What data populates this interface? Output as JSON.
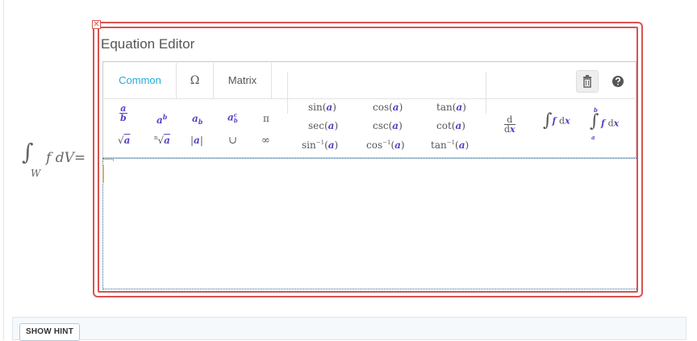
{
  "expression": {
    "integral_sign": "∫",
    "subscript": "W",
    "integrand": "f dV",
    "equals": "="
  },
  "close_icon_glyph": "✕",
  "editor": {
    "title": "Equation Editor",
    "tabs": [
      {
        "label": "Common",
        "active": true
      },
      {
        "label": "Ω",
        "active": false
      },
      {
        "label": "Matrix",
        "active": false
      }
    ],
    "toolbar": {
      "trash_icon": "trash-icon",
      "help_icon": "help-circle-icon"
    },
    "symbols": {
      "fraction": {
        "num": "a",
        "den": "b"
      },
      "power": {
        "base": "a",
        "sup": "b"
      },
      "subscript": {
        "base": "a",
        "sub": "b"
      },
      "sub_sup": {
        "base": "a",
        "sup": "c",
        "sub": "b"
      },
      "pi": "π",
      "sqrt": {
        "sign": "√",
        "arg": "a"
      },
      "nth_root": {
        "index": "n",
        "sign": "√",
        "arg": "a"
      },
      "abs": {
        "bar": "|",
        "arg": "a"
      },
      "union": "∪",
      "infinity": "∞",
      "trig": [
        {
          "fn": "sin",
          "arg": "a"
        },
        {
          "fn": "cos",
          "arg": "a"
        },
        {
          "fn": "tan",
          "arg": "a"
        },
        {
          "fn": "sec",
          "arg": "a"
        },
        {
          "fn": "csc",
          "arg": "a"
        },
        {
          "fn": "cot",
          "arg": "a"
        },
        {
          "fn": "sin",
          "sup": "−1",
          "arg": "a"
        },
        {
          "fn": "cos",
          "sup": "−1",
          "arg": "a"
        },
        {
          "fn": "tan",
          "sup": "−1",
          "arg": "a"
        }
      ],
      "derivative": {
        "num": "d",
        "den_d": "d",
        "den_var": "x"
      },
      "integral": {
        "sign": "∫",
        "f": "f",
        "d": "d",
        "var": "x"
      },
      "definite_integral": {
        "sign": "∫",
        "upper": "b",
        "lower": "a",
        "f": "f",
        "d": "d",
        "var": "x"
      }
    }
  },
  "hint": {
    "button_label": "SHOW HINT"
  },
  "colors": {
    "frame": "#d9534f",
    "accent": "#29a8d8",
    "symbol": "#5b3fc4"
  }
}
